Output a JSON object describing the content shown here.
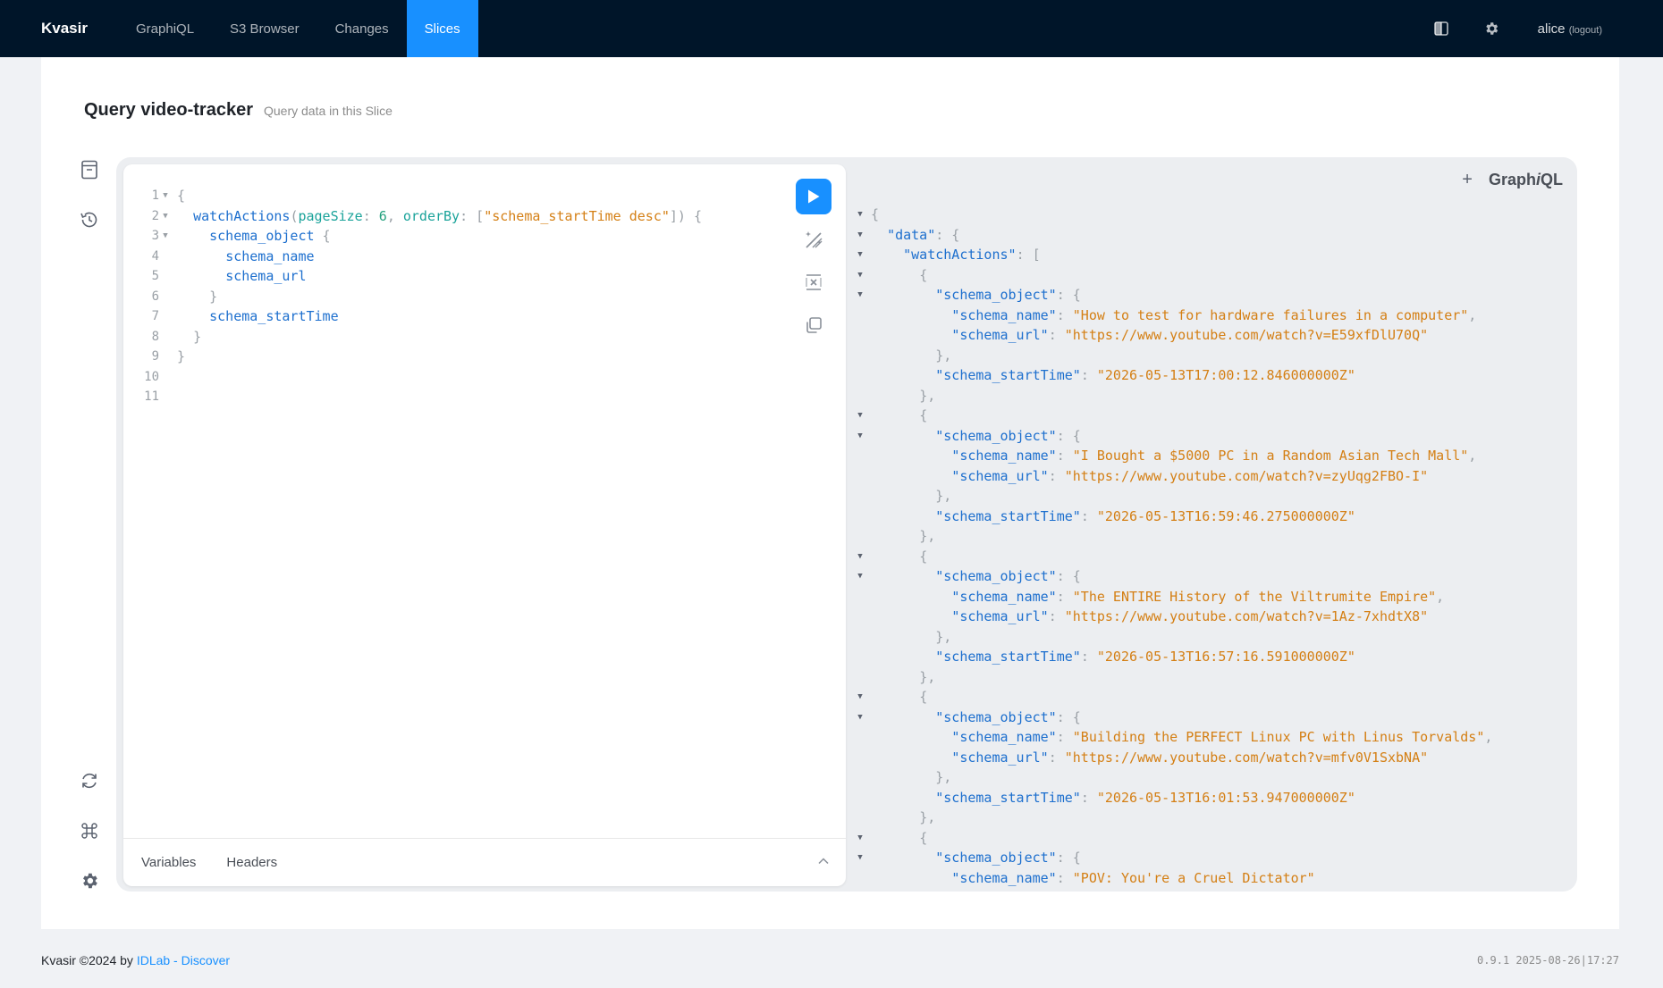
{
  "nav": {
    "brand": "Kvasir",
    "items": [
      {
        "label": "GraphiQL"
      },
      {
        "label": "S3 Browser"
      },
      {
        "label": "Changes"
      },
      {
        "label": "Slices"
      }
    ],
    "user": "alice",
    "logout": "(logout)"
  },
  "page": {
    "title": "Query video-tracker",
    "subtitle": "Query data in this Slice"
  },
  "editor": {
    "line_numbers": [
      "1",
      "2",
      "3",
      "4",
      "5",
      "6",
      "7",
      "8",
      "9",
      "10",
      "11"
    ],
    "variables_tab": "Variables",
    "headers_tab": "Headers"
  },
  "result": {
    "plus": "+",
    "logo_a": "Graph",
    "logo_b": "i",
    "logo_c": "QL",
    "items": [
      {
        "name": "How to test for hardware failures in a computer",
        "url": "https://www.youtube.com/watch?v=E59xfDlU70Q",
        "startTime": "2026-05-13T17:00:12.846000000Z"
      },
      {
        "name": "I Bought a $5000 PC in a Random Asian Tech Mall",
        "url": "https://www.youtube.com/watch?v=zyUqg2FBO-I",
        "startTime": "2026-05-13T16:59:46.275000000Z"
      },
      {
        "name": "The ENTIRE History of the Viltrumite Empire",
        "url": "https://www.youtube.com/watch?v=1Az-7xhdtX8",
        "startTime": "2026-05-13T16:57:16.591000000Z"
      },
      {
        "name": "Building the PERFECT Linux PC with Linus Torvalds",
        "url": "https://www.youtube.com/watch?v=mfv0V1SxbNA",
        "startTime": "2026-05-13T16:01:53.947000000Z"
      },
      {
        "name": "POV: You're a Cruel Dictator"
      }
    ]
  },
  "footer": {
    "text": "Kvasir ©2024 by ",
    "link": "IDLab - Discover",
    "version": "0.9.1 2025-08-26|17:27"
  }
}
